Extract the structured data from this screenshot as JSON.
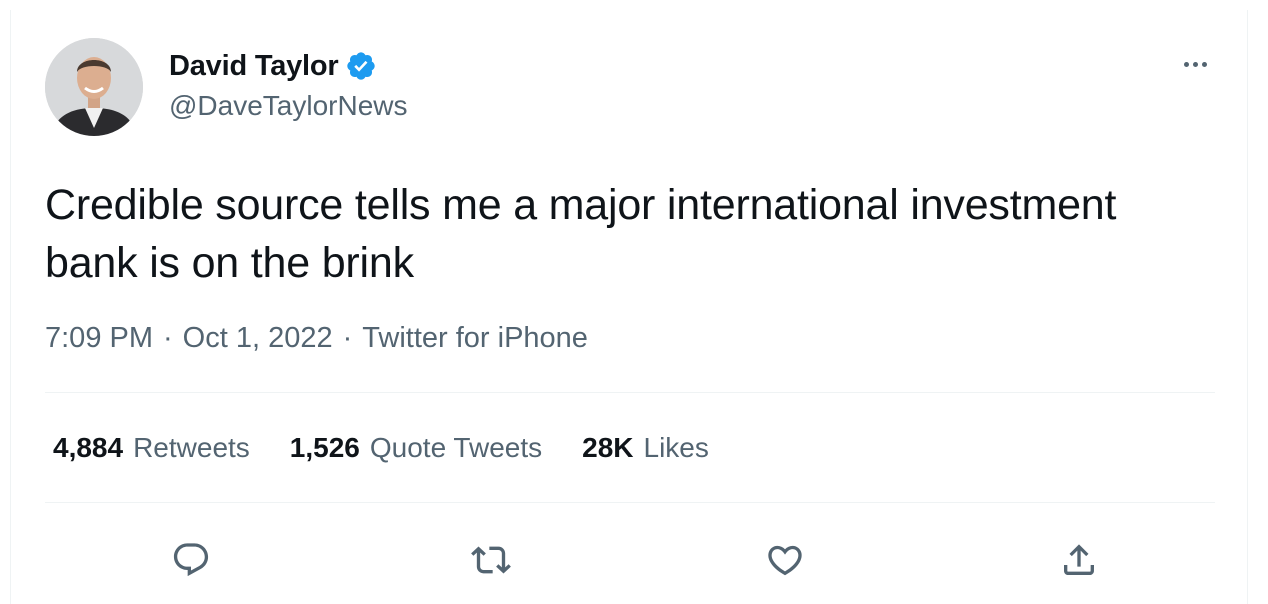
{
  "author": {
    "display_name": "David Taylor",
    "handle": "@DaveTaylorNews",
    "verified": true
  },
  "tweet": {
    "text": "Credible source tells me a major international investment bank is on the brink",
    "time": "7:09 PM",
    "date": "Oct 1, 2022",
    "source": "Twitter for iPhone",
    "separator": "·"
  },
  "stats": {
    "retweets": {
      "count": "4,884",
      "label": "Retweets"
    },
    "quotes": {
      "count": "1,526",
      "label": "Quote Tweets"
    },
    "likes": {
      "count": "28K",
      "label": "Likes"
    }
  },
  "icons": {
    "more": "more-dots-icon",
    "reply": "reply-icon",
    "retweet": "retweet-icon",
    "like": "heart-icon",
    "share": "share-icon",
    "verified": "verified-badge-icon"
  },
  "colors": {
    "text": "#0f1419",
    "secondary": "#536471",
    "verified": "#1d9bf0",
    "divider": "#eff3f4"
  }
}
